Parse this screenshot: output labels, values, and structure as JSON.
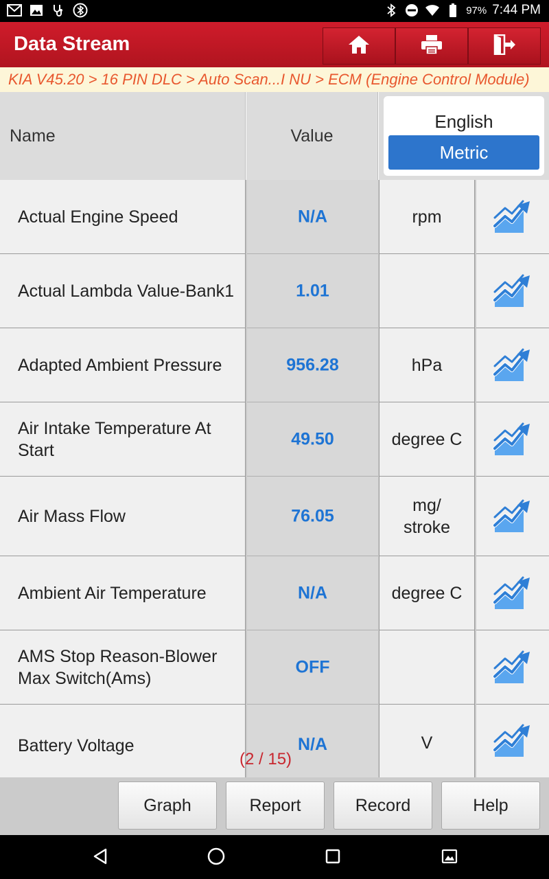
{
  "status_bar": {
    "battery_percent": "97%",
    "time": "7:44 PM",
    "left_icons": [
      "gmail-icon",
      "image-icon",
      "stethoscope-icon",
      "bluetooth-circle-icon"
    ],
    "right_icons": [
      "bluetooth-icon",
      "do-not-disturb-icon",
      "wifi-icon",
      "battery-icon"
    ]
  },
  "header": {
    "title": "Data Stream",
    "buttons": [
      "home-icon",
      "printer-icon",
      "exit-icon"
    ]
  },
  "breadcrumb": "KIA V45.20 > 16 PIN DLC > Auto Scan...I NU > ECM (Engine Control Module)",
  "table": {
    "columns": {
      "name": "Name",
      "value": "Value"
    },
    "unit_toggle": {
      "english": "English",
      "metric": "Metric",
      "selected": "Metric"
    },
    "rows": [
      {
        "name": "Actual Engine Speed",
        "value": "N/A",
        "unit": "rpm"
      },
      {
        "name": "Actual Lambda Value-Bank1",
        "value": "1.01",
        "unit": ""
      },
      {
        "name": "Adapted Ambient Pressure",
        "value": "956.28",
        "unit": "hPa"
      },
      {
        "name": "Air Intake Temperature At Start",
        "value": "49.50",
        "unit": "degree C"
      },
      {
        "name": "Air Mass Flow",
        "value": "76.05",
        "unit": "mg/ stroke"
      },
      {
        "name": "Ambient Air Temperature",
        "value": "N/A",
        "unit": "degree C"
      },
      {
        "name": "AMS Stop Reason-Blower Max Switch(Ams)",
        "value": "OFF",
        "unit": ""
      },
      {
        "name": "Battery Voltage",
        "value": "N/A",
        "unit": "V"
      }
    ]
  },
  "pagination": "(2 / 15)",
  "bottom_buttons": {
    "graph": "Graph",
    "report": "Report",
    "record": "Record",
    "help": "Help"
  },
  "nav_bar": [
    "back-icon",
    "home-circle-icon",
    "recents-icon",
    "screenshot-icon"
  ],
  "colors": {
    "header_red": "#c41a26",
    "value_blue": "#1e74d4",
    "breadcrumb_orange": "#e8572e",
    "metric_blue": "#2d75cc"
  }
}
